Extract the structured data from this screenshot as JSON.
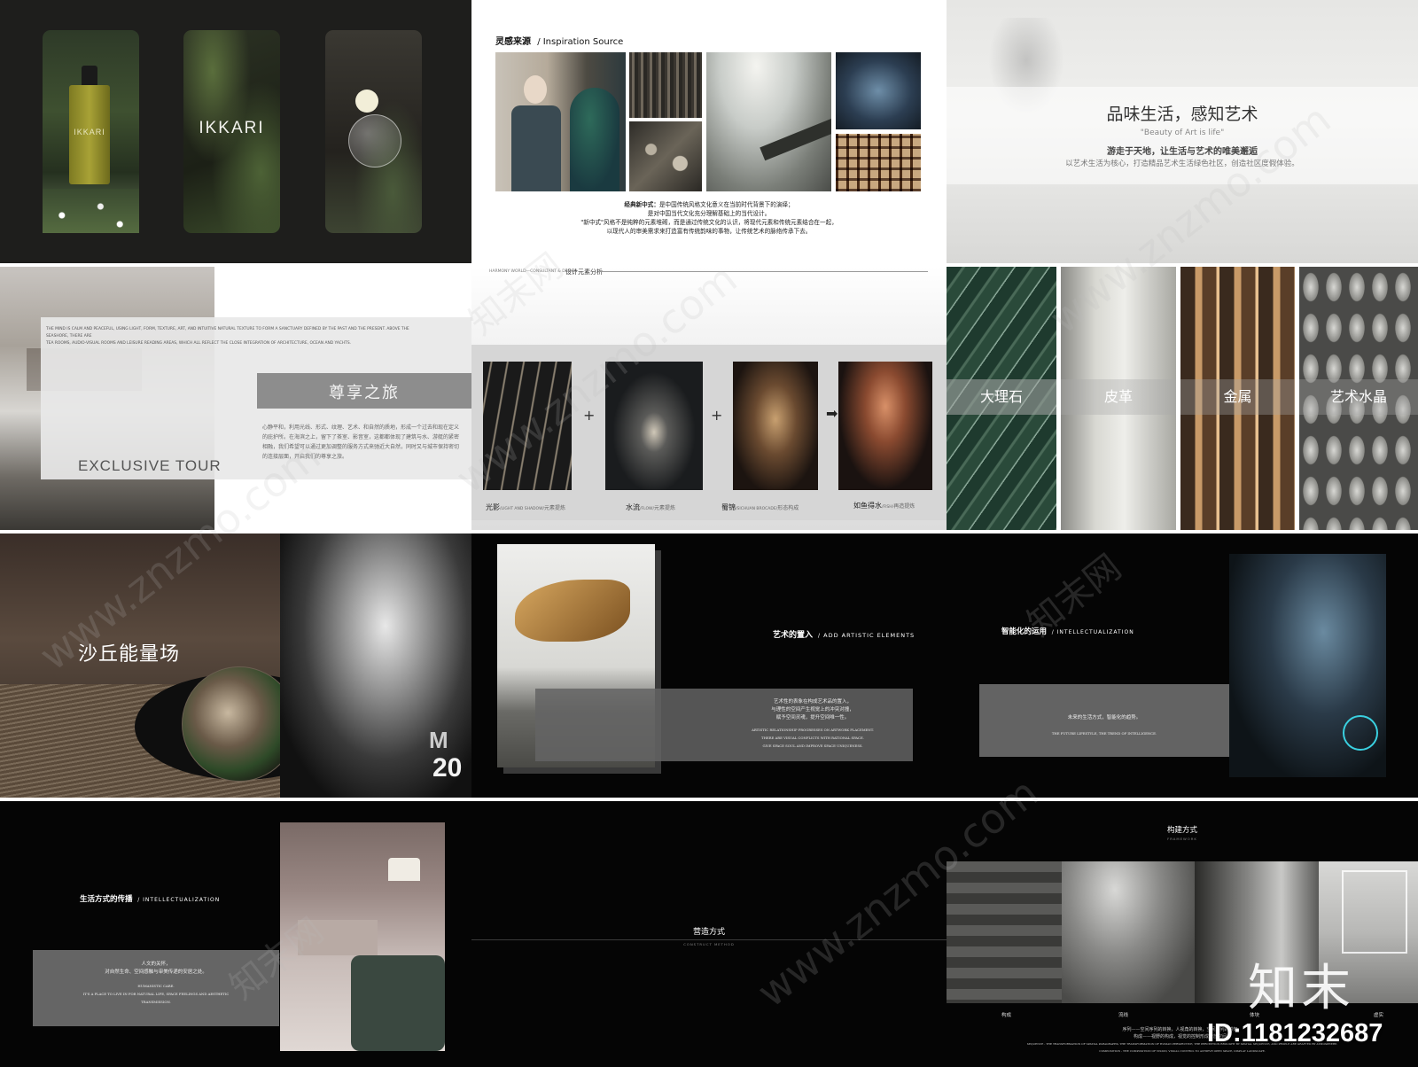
{
  "p1": {
    "phone2_brand": "IKKARI",
    "phone1_brand": "IKKARI"
  },
  "p2": {
    "title_cn": "灵感来源",
    "title_en": "/ Inspiration Source",
    "text_lead": "经典新中式：",
    "text1": "是中国传统风格文化意义在当前时代背景下的演绎；",
    "text2": "是对中国当代文化充分理解基础上的当代设计。",
    "text3": "\"新中式\"风格不是纯粹的元素堆砌，而是通过传统文化的认识，将现代元素和传统元素结合在一起，",
    "text4": "以现代人的审美需求来打造富有传统韵味的事物，让传统艺术的脉络传承下去。"
  },
  "p3": {
    "title": "品味生活，感知艺术",
    "subtitle_en": "\"Beauty of Art is life\"",
    "line1": "游走于天地，让生活与艺术的唯美邂逅",
    "line2": "以艺术生活为核心，打造精品艺术生活绿色社区，创造社区度假体验。"
  },
  "p4": {
    "en_line1": "THE MIND IS CALM AND PEACEFUL, USING LIGHT, FORM, TEXTURE, ART, AND INTUITIVE NATURAL TEXTURE TO FORM A SANCTUARY DEFINED BY THE PAST AND THE PRESENT. ABOVE THE SEASHORE, THERE ARE",
    "en_line2": "TEA ROOMS, AUDIO-VISUAL ROOMS AND LEISURE READING AREAS, WHICH ALL REFLECT THE CLOSE INTEGRATION OF ARCHITECTURE, OCEAN AND YACHTS.",
    "title": "尊享之旅",
    "body": "心静平和，利用光线、形式、纹理、艺术、和自然的质地，形成一个过去和现在定义的庇护所。在海滨之上，留下了茶室、影音室，这都都体现了建筑与水、游艇的紧密相融，我们希望可以通过更加调整的服务方式来驰近大自然，同时又与城市保持密切的连接层面，开启我们的尊享之旅。",
    "en_title": "EXCLUSIVE TOUR"
  },
  "p5": {
    "header_left": "HARMONY WORLD—CONSULTANT & DESIGN",
    "header_right": "设计元素分析",
    "plus": "+",
    "arrow": "➡",
    "items": [
      {
        "cn": "光影",
        "en": "/LIGHT AND SHADOW/",
        "tail": "元素提炼"
      },
      {
        "cn": "水流",
        "en": "/FLOW/",
        "tail": "元素提炼"
      },
      {
        "cn": "蜀锦",
        "en": "/SICHUAN BROCADE/",
        "tail": "形态构成"
      },
      {
        "cn": "如鱼得水",
        "en": "/FISH/",
        "tail": "再造提炼"
      }
    ]
  },
  "p6": {
    "labels": [
      "大理石",
      "皮革",
      "金属",
      "艺术水晶"
    ]
  },
  "p7": {
    "title": "沙丘能量场",
    "logo": "M",
    "num": "20"
  },
  "p8": {
    "title": "艺术的置入",
    "title_en": "/ ADD ARTISTIC ELEMENTS",
    "cn1": "艺术性的表象在构成艺术品的置入，",
    "cn2": "与理性的空间产生视觉上的冲突对撞，",
    "cn3": "赋予空间灵魂，提升空间唯一性。",
    "en1": "ARTISTIC RELATIONSHIP PROGRESSES ON ARTWORK PLACEMENT.",
    "en2": "THERE ARE VISUAL CONFLICTS WITH RATIONAL SPACE.",
    "en3": "GIVE SPACE SOUL AND IMPROVE SPACE UNIQUENESS."
  },
  "p9": {
    "title": "智能化的运用",
    "title_en": "/ INTELLECTUALIZATION",
    "cn": "未来的生活方式，智能化的趋势。",
    "en": "THE FUTURE LIFESTYLE, THE TREND OF INTELLIGENCE."
  },
  "p10": {
    "title": "生活方式的传播",
    "title_en": "/ INTELLECTUALIZATION",
    "cn1": "人文的关怀，",
    "cn2": "对自然生命、空间感触与审美传递的安居之处。",
    "en_small": "HUMANISTIC CARE.",
    "en1": "IT'S A PLACE TO LIVE IN FOR NATURAL LIFE, SPACE FEELINGS AND AESTHETIC",
    "en2": "TRANSMISSION."
  },
  "p11": {
    "title": "营造方式",
    "sub": "CONSTRUCT METHOD"
  },
  "p12": {
    "title": "构建方式",
    "sub": "FRAMEWORK",
    "captions": [
      "构成",
      "流线",
      "体块",
      "虚实"
    ],
    "text1": "序列——空间序列的转换，人视角的转换，空间序列的感知，",
    "text2": "构成——视野的构成，视觉的控制形成开放空间，",
    "en1": "SEQUENCE - THE TRANSFORMATION OF SPATIAL PARAGRAPHS, THE TRANSFORMATION OF HUMAN PERSPECTIVE, THE PERCEPTION BROUGHT BY SPATIAL SEQUENCE, AND PEOPLE ARE GRAFTED BY ATMOSPHERE.",
    "en2": "COMPOSITION - THE COMPOSITION OF VISION, VISUAL CONTROL TO ACHIEVE OPEN SPACE, DISPLAY LANDSCAPE."
  },
  "watermark": {
    "site": "www.znzmo.com",
    "brand": "知末网",
    "brand_big": "知末",
    "id": "ID:1181232687"
  }
}
